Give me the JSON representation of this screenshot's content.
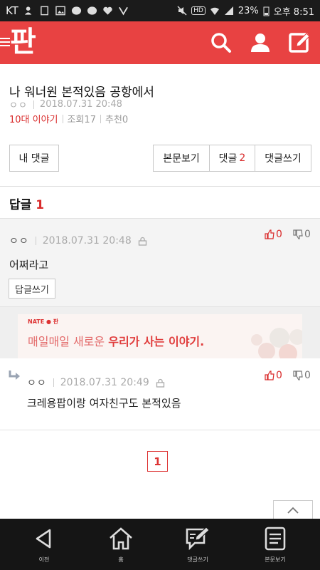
{
  "status_bar": {
    "carrier": "KT",
    "hd": "HD",
    "battery": "23%",
    "time": "오후 8:51"
  },
  "header": {
    "logo": "판",
    "icons": [
      "menu-icon",
      "search-icon",
      "user-icon",
      "write-icon"
    ]
  },
  "post": {
    "title": "나 워너원 본적있음 공항에서",
    "author": "ㅇㅇ",
    "date": "2018.07.31 20:48",
    "category": "10대 이야기",
    "views": "조회17",
    "recommends": "추천0"
  },
  "buttons": {
    "my_comments": "내 댓글",
    "view_post": "본문보기",
    "comments": "댓글",
    "comments_count": "2",
    "write_comment": "댓글쓰기"
  },
  "replies": {
    "heading": "답글",
    "count": "1"
  },
  "comment1": {
    "author": "ㅇㅇ",
    "date": "2018.07.31 20:48",
    "text": "어쩌라고",
    "upvotes": "0",
    "downvotes": "0",
    "reply_button": "답글쓰기"
  },
  "ad": {
    "brand": "NATE ● 판",
    "text_normal": "매일매일 새로운",
    "text_bold": "우리가 사는 이야기."
  },
  "comment2": {
    "author": "ㅇㅇ",
    "date": "2018.07.31 20:49",
    "text": "크레용팝이랑 여자친구도 본적있음",
    "upvotes": "0",
    "downvotes": "0"
  },
  "pagination": {
    "current": "1"
  },
  "bottom_nav": [
    {
      "label": "이전",
      "icon": "back-icon"
    },
    {
      "label": "홈",
      "icon": "home-icon"
    },
    {
      "label": "댓글쓰기",
      "icon": "comment-write-icon"
    },
    {
      "label": "본문보기",
      "icon": "document-icon"
    }
  ],
  "colors": {
    "accent": "#e84242",
    "accent_text": "#d92b2b"
  }
}
